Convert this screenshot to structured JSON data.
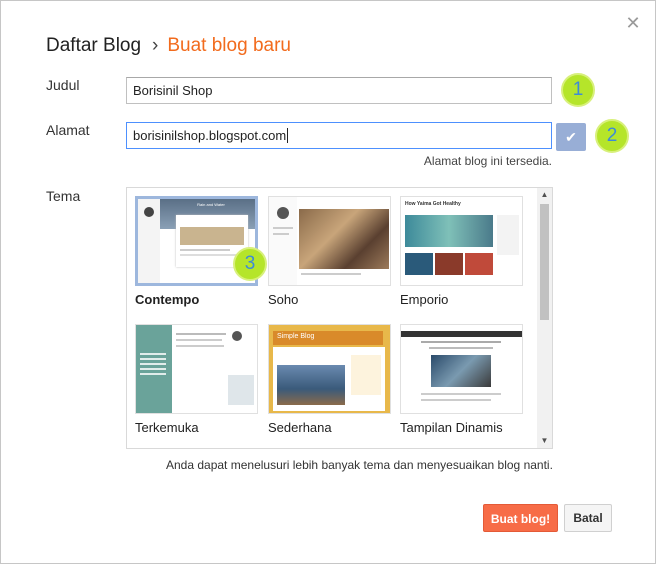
{
  "header": {
    "crumb": "Daftar Blog",
    "separator": "›",
    "current": "Buat blog baru"
  },
  "form": {
    "title_label": "Judul",
    "title_value": "Borisinil Shop",
    "address_label": "Alamat",
    "address_value": "borisinilshop.blogspot.com",
    "availability": "Alamat blog ini tersedia.",
    "theme_label": "Tema"
  },
  "markers": [
    "1",
    "2",
    "3"
  ],
  "themes": [
    {
      "name": "Contempo",
      "selected": true,
      "thumb_title": "Rain and Water"
    },
    {
      "name": "Soho",
      "selected": false,
      "thumb_title": ""
    },
    {
      "name": "Emporio",
      "selected": false,
      "thumb_title": "How Yaima Got Healthy"
    },
    {
      "name": "Terkemuka",
      "selected": false,
      "thumb_title": ""
    },
    {
      "name": "Sederhana",
      "selected": false,
      "thumb_title": "Simple Blog"
    },
    {
      "name": "Tampilan Dinamis",
      "selected": false,
      "thumb_title": ""
    }
  ],
  "hint": "Anda dapat menelusuri lebih banyak tema dan menyesuaikan blog nanti.",
  "buttons": {
    "create": "Buat blog!",
    "cancel": "Batal"
  },
  "colors": {
    "accent": "#f26b1d",
    "primary_button": "#f76c47",
    "marker": "#b5e52a",
    "marker_text": "#3d8ad8"
  },
  "icons": {
    "close": "close-icon",
    "check": "check-icon"
  }
}
